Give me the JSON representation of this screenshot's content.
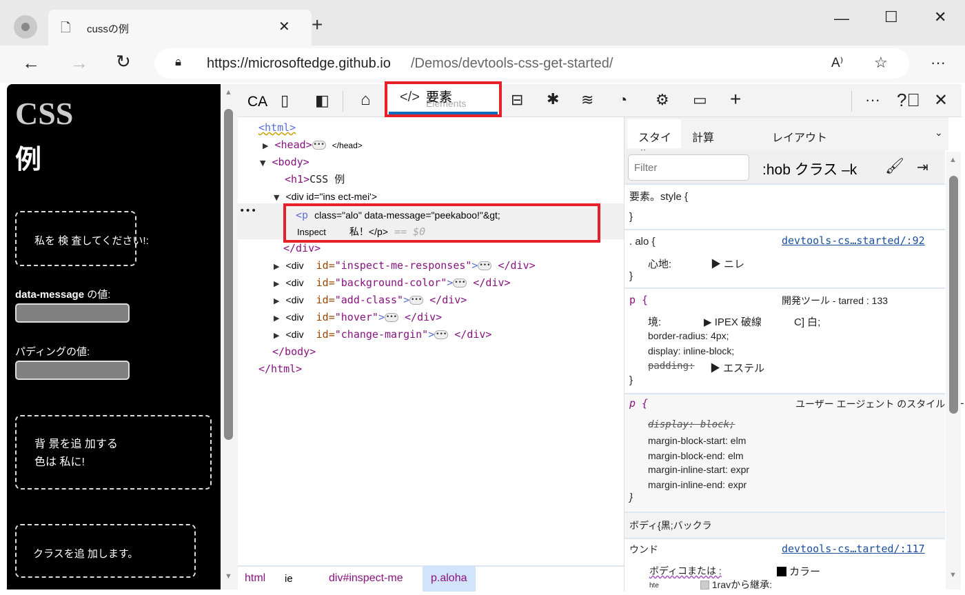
{
  "browser": {
    "tab_title": "cussの例",
    "url_host": "https://microsoftedge.github.io",
    "url_path": "/Demos/devtools-css-get-started/"
  },
  "page": {
    "h1_line1": "CSS",
    "h1_line2": "例",
    "inspect_box": "私を 検 査してください!:",
    "data_message_label_a": "data-message",
    "data_message_label_b": " の値:",
    "padding_label": "パディングの値:",
    "bg_box_line1": "背 景を追 加する",
    "bg_box_line2": "色は 私に!",
    "class_box": "クラスを追 加します。"
  },
  "devtools": {
    "toolbar": {
      "ca": "CA",
      "elements_tab": "要素",
      "elements_tab_under": "Elements"
    },
    "dom": {
      "html_open": "<html>",
      "head": "<head>",
      "head_close": "</head>",
      "body": "<body>",
      "h1": "<h1>",
      "h1_text": "CSS 例",
      "div_inspect": "<div id=\"ins ect-mei'>",
      "p_open": "<p",
      "p_attrs": "class=\"alo\" data-message=\"peekaboo!\"&gt;",
      "inspect_label": "Inspect",
      "p_text": "私！</p>",
      "eq0": "== $0",
      "div_close": "</div>",
      "divs": [
        {
          "tag": "<div",
          "attr": "id=",
          "val": "\"inspect-me-responses\""
        },
        {
          "tag": "<div",
          "attr": "id=",
          "val": "\"background-color\""
        },
        {
          "tag": "<div",
          "attr": "id=",
          "val": "\"add-class\""
        },
        {
          "tag": "<div",
          "attr": "id=",
          "val": "\"hover\""
        },
        {
          "tag": "<div",
          "attr": "id=",
          "val": "\"change-margin\""
        }
      ],
      "body_close": "</body>",
      "html_close": "</html>"
    },
    "breadcrumbs": [
      "html",
      "ie",
      "div#inspect-me",
      "p.aloha"
    ],
    "styles": {
      "tabs": [
        "スタイル",
        "計算",
        "レイアウト"
      ],
      "filter_placeholder": "Filter",
      "hov_cls": ":hob クラス –k",
      "element_style": "要素。style {",
      "close": "}",
      "alo_sel": ". alo {",
      "alo_link": "devtools-cs…started/:92",
      "alo_prop": "心地:",
      "alo_val": "ニレ",
      "p_sel": "p {",
      "p_src": "開発ツール - tarred : 133",
      "p_props": [
        "境:",
        "border-radius: 4px;",
        "display: inline-block;",
        "padding:"
      ],
      "p_border_val": "IPEX 破線",
      "p_border_color": "C] 白;",
      "p_padding_val": "エステル",
      "ua_sel": "p {",
      "ua_src": "ユーザー エージェント のスタイルシート",
      "ua_display": "display: block;",
      "ua_props": [
        "margin-block-start: elm",
        "margin-block-end: elm",
        "margin-inline-start: expr",
        "margin-inline-end: expr"
      ],
      "inherited": "ボディ{黒;バックラ",
      "body_sel": "ウンド",
      "body_link": "devtools-cs…tarted/:117",
      "body_prop": "ボディコまたは :",
      "body_val": "カラー",
      "hte": "hte",
      "inherit_from": "1ravから継承:"
    }
  }
}
